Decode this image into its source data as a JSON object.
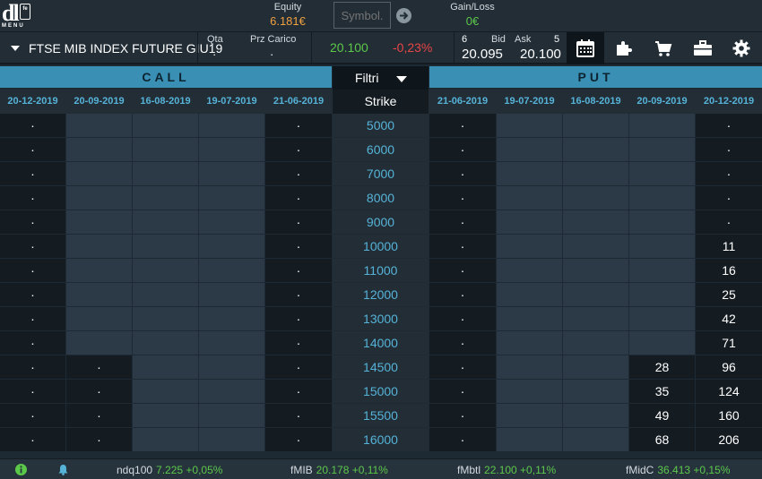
{
  "header": {
    "logo_text": "dl",
    "logo_menu": "MENU",
    "logo_box": "fe",
    "equity_label": "Equity",
    "equity_value": "6.181€",
    "symbol_placeholder": "Symbol.",
    "gainloss_label": "Gain/Loss",
    "gainloss_value": "0€"
  },
  "instrument": {
    "name": "FTSE MIB INDEX FUTURE GIU19",
    "qta_label": "Qta",
    "qta_value": "·",
    "prz_label": "Prz Carico",
    "prz_value": "·",
    "last": "20.100",
    "change": "-0,23%",
    "bid_qty": "6",
    "bid_label": "Bid",
    "bid": "20.095",
    "ask_label": "Ask",
    "ask_qty": "5",
    "ask": "20.100"
  },
  "toolbar": [
    "calendar-icon",
    "puzzle-icon",
    "cart-icon",
    "briefcase-icon",
    "gear-icon"
  ],
  "table": {
    "call_label": "CALL",
    "put_label": "PUT",
    "filtri_label": "Filtri",
    "strike_label": "Strike",
    "call_dates": [
      "20-12-2019",
      "20-09-2019",
      "16-08-2019",
      "19-07-2019",
      "21-06-2019"
    ],
    "put_dates": [
      "21-06-2019",
      "19-07-2019",
      "16-08-2019",
      "20-09-2019",
      "20-12-2019"
    ],
    "rows": [
      {
        "strike": "5000",
        "call": [
          "·",
          "",
          "",
          "",
          "·"
        ],
        "put": [
          "·",
          "",
          "",
          "",
          "·"
        ]
      },
      {
        "strike": "6000",
        "call": [
          "·",
          "",
          "",
          "",
          "·"
        ],
        "put": [
          "·",
          "",
          "",
          "",
          "·"
        ]
      },
      {
        "strike": "7000",
        "call": [
          "·",
          "",
          "",
          "",
          "·"
        ],
        "put": [
          "·",
          "",
          "",
          "",
          "·"
        ]
      },
      {
        "strike": "8000",
        "call": [
          "·",
          "",
          "",
          "",
          "·"
        ],
        "put": [
          "·",
          "",
          "",
          "",
          "·"
        ]
      },
      {
        "strike": "9000",
        "call": [
          "·",
          "",
          "",
          "",
          "·"
        ],
        "put": [
          "·",
          "",
          "",
          "",
          "·"
        ]
      },
      {
        "strike": "10000",
        "call": [
          "·",
          "",
          "",
          "",
          "·"
        ],
        "put": [
          "·",
          "",
          "",
          "",
          "11"
        ]
      },
      {
        "strike": "11000",
        "call": [
          "·",
          "",
          "",
          "",
          "·"
        ],
        "put": [
          "·",
          "",
          "",
          "",
          "16"
        ]
      },
      {
        "strike": "12000",
        "call": [
          "·",
          "",
          "",
          "",
          "·"
        ],
        "put": [
          "·",
          "",
          "",
          "",
          "25"
        ]
      },
      {
        "strike": "13000",
        "call": [
          "·",
          "",
          "",
          "",
          "·"
        ],
        "put": [
          "·",
          "",
          "",
          "",
          "42"
        ]
      },
      {
        "strike": "14000",
        "call": [
          "·",
          "",
          "",
          "",
          "·"
        ],
        "put": [
          "·",
          "",
          "",
          "",
          "71"
        ]
      },
      {
        "strike": "14500",
        "call": [
          "·",
          "·",
          "",
          "",
          "·"
        ],
        "put": [
          "·",
          "",
          "",
          "28",
          "96"
        ]
      },
      {
        "strike": "15000",
        "call": [
          "·",
          "·",
          "",
          "",
          "·"
        ],
        "put": [
          "·",
          "",
          "",
          "35",
          "124"
        ]
      },
      {
        "strike": "15500",
        "call": [
          "·",
          "·",
          "",
          "",
          "·"
        ],
        "put": [
          "·",
          "",
          "",
          "49",
          "160"
        ]
      },
      {
        "strike": "16000",
        "call": [
          "·",
          "·",
          "",
          "",
          "·"
        ],
        "put": [
          "·",
          "",
          "",
          "68",
          "206"
        ]
      }
    ]
  },
  "footer": {
    "tickers": [
      {
        "name": "ndq100",
        "value": "7.225 +0,05%"
      },
      {
        "name": "fMIB",
        "value": "20.178 +0,11%"
      },
      {
        "name": "fMbtl",
        "value": "22.100 +0,11%"
      },
      {
        "name": "fMidC",
        "value": "36.413 +0,15%"
      }
    ]
  },
  "colors": {
    "accent": "#3a8fb4",
    "positive": "#5cc84a",
    "negative": "#e84545",
    "equity": "#f0a040",
    "strike_text": "#56b3d8"
  }
}
